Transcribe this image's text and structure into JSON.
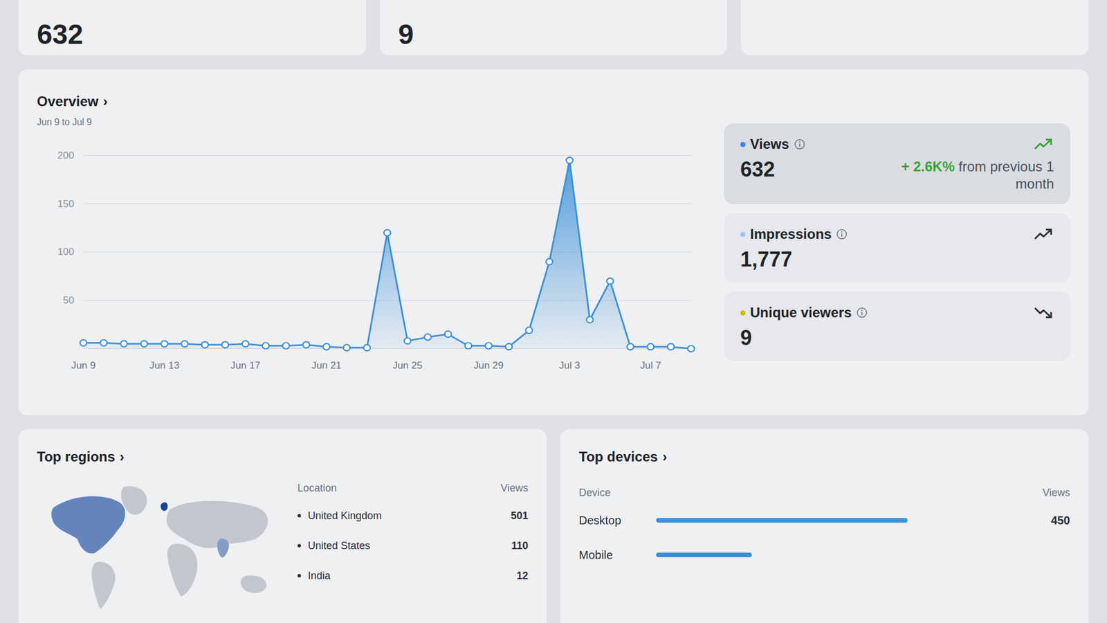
{
  "top_cards": [
    {
      "value": "632"
    },
    {
      "value": "9"
    }
  ],
  "overview": {
    "title": "Overview",
    "chevron": "›",
    "range": "Jun 9 to Jul 9",
    "chart": {
      "y_ticks": [
        "200",
        "150",
        "100",
        "50"
      ],
      "y_tick_values": [
        200,
        150,
        100,
        50
      ],
      "y_max": 200,
      "x_labels": [
        "Jun 9",
        "Jun 13",
        "Jun 17",
        "Jun 21",
        "Jun 25",
        "Jun 29",
        "Jul 3",
        "Jul 7"
      ],
      "series": [
        {
          "name": "Views",
          "color": "#3b8fd9",
          "values": [
            6,
            6,
            5,
            5,
            5,
            5,
            4,
            4,
            5,
            3,
            3,
            4,
            2,
            1,
            1,
            120,
            8,
            12,
            15,
            3,
            3,
            2,
            19,
            90,
            195,
            30,
            70,
            2,
            2,
            2,
            0
          ]
        }
      ]
    }
  },
  "stats": [
    {
      "label": "Views",
      "value": "632",
      "change": "+ 2.6K%",
      "change_note": "from previous 1 month",
      "trend": "up",
      "selected": true,
      "color": "#3b82f6"
    },
    {
      "label": "Impressions",
      "value": "1,777",
      "trend": "up",
      "selected": false,
      "color": "#93c5fd"
    },
    {
      "label": "Unique viewers",
      "value": "9",
      "trend": "down",
      "selected": false,
      "color": "#c9b81c"
    }
  ],
  "regions": {
    "title": "Top regions",
    "chevron": "›",
    "columns": [
      "Location",
      "Views"
    ],
    "rows": [
      {
        "location": "United Kingdom",
        "views": "501",
        "level": 1.0
      },
      {
        "location": "United States",
        "views": "110",
        "level": 0.22
      },
      {
        "location": "India",
        "views": "12",
        "level": 0.05
      }
    ]
  },
  "devices": {
    "title": "Top devices",
    "chevron": "›",
    "columns": [
      "Device",
      "Views"
    ],
    "rows": [
      {
        "device": "Desktop",
        "views": "450",
        "level": 0.71
      },
      {
        "device": "Mobile",
        "level": 0.27
      }
    ]
  }
}
